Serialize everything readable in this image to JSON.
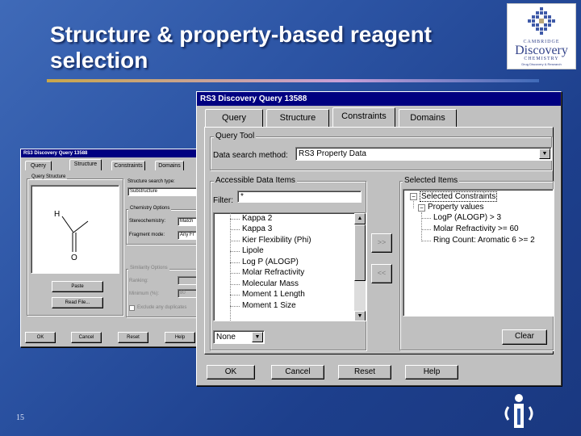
{
  "slide": {
    "title": "Structure & property-based reagent selection",
    "page_number": "15",
    "logo": {
      "line1": "CAMBRIDGE",
      "line2": "Discovery",
      "line3": "CHEMISTRY",
      "line4": "Drug Discovery & Research"
    }
  },
  "main_dialog": {
    "title": "RS3 Discovery Query 13588",
    "tabs": [
      "Query",
      "Structure",
      "Constraints",
      "Domains"
    ],
    "query_tool_label": "Query Tool",
    "data_search_label": "Data search method:",
    "data_search_value": "RS3 Property Data",
    "accessible_label": "Accessible Data Items",
    "filter_label": "Filter:",
    "filter_value": "*",
    "accessible_items": [
      "Kappa 2",
      "Kappa 3",
      "Kier Flexibility (Phi)",
      "Lipole",
      "Log P (ALOGP)",
      "Molar Refractivity",
      "Molecular Mass",
      "Moment 1 Length",
      "Moment 1 Size"
    ],
    "add_button": ">>",
    "remove_button": "<<",
    "selected_label": "Selected Items",
    "selected_tree": {
      "root": "Selected Constraints",
      "group": "Property values",
      "items": [
        "LogP (ALOGP) > 3",
        "Molar Refractivity >= 60",
        "Ring Count: Aromatic 6 >= 2"
      ]
    },
    "none_select": "None",
    "clear_button": "Clear",
    "buttons": [
      "OK",
      "Cancel",
      "Reset",
      "Help"
    ]
  },
  "back_dialog": {
    "title": "RS3 Discovery Query 13588",
    "tabs": [
      "Query",
      "Structure",
      "Constraints",
      "Domains"
    ],
    "query_structure_label": "Query Structure",
    "atom_h": "H",
    "atom_o": "O",
    "paste_button": "Paste",
    "read_file_button": "Read File...",
    "search_type_label": "Structure search type:",
    "search_type_value": "Substructure",
    "chemistry_label": "Chemistry Options",
    "stereochem_label": "Stereochemistry:",
    "stereochem_value": "Match",
    "fragment_label": "Fragment mode:",
    "fragment_value": "Any Fr",
    "similarity_label": "Similarity Options",
    "similarity_row1": "Ranking:",
    "similarity_row2": "Minimum (%):",
    "similarity_row2_value": "80",
    "checkbox_label": "Exclude any duplicates",
    "buttons": [
      "OK",
      "Cancel",
      "Reset",
      "Help"
    ]
  }
}
